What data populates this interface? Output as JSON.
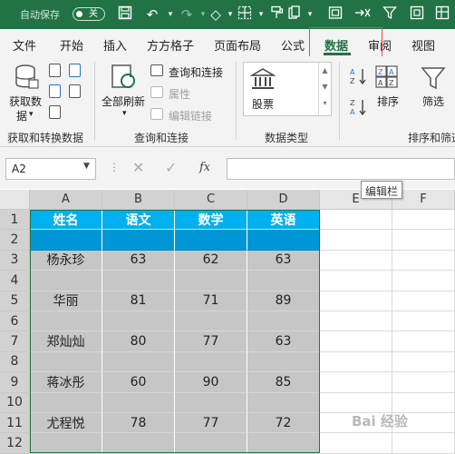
{
  "titlebar": {
    "autosave_label": "自动保存",
    "autosave_state": "关",
    "qat_icons": [
      "save-icon",
      "undo-icon",
      "redo-icon",
      "eraser-icon",
      "borders-icon",
      "format-painter-icon",
      "print-preview-icon",
      "close-sheet-icon",
      "filter-icon",
      "frame-icon"
    ]
  },
  "tabs": [
    "文件",
    "开始",
    "插入",
    "方方格子",
    "页面布局",
    "公式",
    "数据",
    "审阅",
    "视图"
  ],
  "ribbon": {
    "get_data_line1": "获取数",
    "get_data_line2": "据",
    "refresh_all": "全部刷新",
    "queries_connections": "查询和连接",
    "properties": "属性",
    "edit_links": "编辑链接",
    "stocks": "股票",
    "sort": "排序",
    "filter": "筛选",
    "group_get_transform": "获取和转换数据",
    "group_queries": "查询和连接",
    "group_data_types": "数据类型",
    "group_sort_filter": "排序和筛选"
  },
  "formula_bar": {
    "name_box": "A2",
    "fx_label": "fx",
    "tooltip": "编辑栏"
  },
  "sheet": {
    "columns": [
      "A",
      "B",
      "C",
      "D",
      "E",
      "F"
    ],
    "rows": [
      "1",
      "2",
      "3",
      "4",
      "5",
      "6",
      "7",
      "8",
      "9",
      "10",
      "11",
      "12"
    ],
    "header": [
      "姓名",
      "语文",
      "数学",
      "英语"
    ],
    "data": [
      [
        "",
        "",
        "",
        ""
      ],
      [
        "杨永珍",
        "63",
        "62",
        "63"
      ],
      [
        "",
        "",
        "",
        ""
      ],
      [
        "华丽",
        "81",
        "71",
        "89"
      ],
      [
        "",
        "",
        "",
        ""
      ],
      [
        "郑灿灿",
        "80",
        "77",
        "63"
      ],
      [
        "",
        "",
        "",
        ""
      ],
      [
        "蒋冰彤",
        "60",
        "90",
        "85"
      ],
      [
        "",
        "",
        "",
        ""
      ],
      [
        "尤程悦",
        "78",
        "77",
        "72"
      ],
      [
        "",
        "",
        "",
        ""
      ]
    ]
  },
  "colors": {
    "brand_green": "#217346",
    "header_fill": "#00b0f0",
    "row2_fill": "#0096d6",
    "selection_gray": "#c6c6c6",
    "highlight_red": "#e8484d"
  },
  "watermark": "Bai 经验"
}
